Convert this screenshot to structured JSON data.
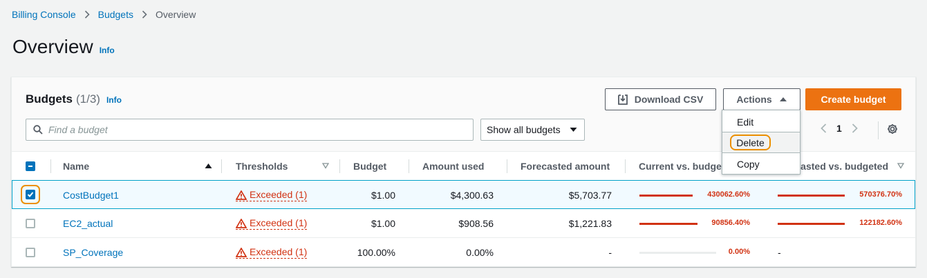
{
  "breadcrumb": [
    "Billing Console",
    "Budgets",
    "Overview"
  ],
  "page": {
    "title": "Overview",
    "info": "Info"
  },
  "panel": {
    "title": "Budgets",
    "count": "(1/3)",
    "info": "Info",
    "download_label": "Download CSV",
    "actions_label": "Actions",
    "create_label": "Create budget",
    "search_placeholder": "Find a budget",
    "filter_value": "Show all budgets",
    "page_number": "1"
  },
  "actions_menu": [
    "Edit",
    "Delete",
    "Copy"
  ],
  "columns": [
    "Name",
    "Thresholds",
    "Budget",
    "Amount used",
    "Forecasted amount",
    "Current vs. budgeted",
    "Forecasted vs. budgeted"
  ],
  "rows": [
    {
      "name": "CostBudget1",
      "threshold": "Exceeded (1)",
      "budget": "$1.00",
      "used": "$4,300.63",
      "forecast": "$5,703.77",
      "current_pct": "430062.60%",
      "current_fill": 1.0,
      "forecast_pct": "570376.70%",
      "forecast_fill": 1.0,
      "selected": true
    },
    {
      "name": "EC2_actual",
      "threshold": "Exceeded (1)",
      "budget": "$1.00",
      "used": "$908.56",
      "forecast": "$1,221.83",
      "current_pct": "90856.40%",
      "current_fill": 1.0,
      "forecast_pct": "122182.60%",
      "forecast_fill": 1.0,
      "selected": false
    },
    {
      "name": "SP_Coverage",
      "threshold": "Exceeded (1)",
      "budget": "100.00%",
      "used": "0.00%",
      "forecast": "-",
      "current_pct": "0.00%",
      "current_fill": 0.0,
      "forecast_pct": "-",
      "forecast_fill": null,
      "selected": false
    }
  ],
  "colors": {
    "link": "#0073bb",
    "primary": "#ec7211",
    "error": "#d13212",
    "highlight": "#ec8f00"
  }
}
